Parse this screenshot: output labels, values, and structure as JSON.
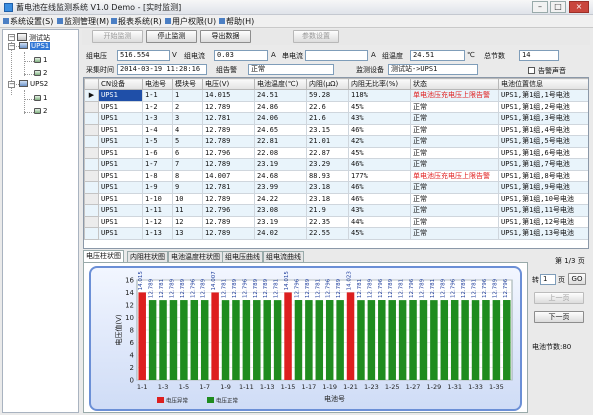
{
  "window": {
    "title": "蓄电池在线监测系统 V1.0 Demo - [实时监测]",
    "min": "–",
    "max": "□",
    "close": "×"
  },
  "menu": [
    {
      "label": "系统设置(S)"
    },
    {
      "label": "监测管理(M)"
    },
    {
      "label": "报表系统(R)"
    },
    {
      "label": "用户权限(U)"
    },
    {
      "label": "帮助(H)"
    }
  ],
  "tree": {
    "root": "测试站",
    "groups": [
      {
        "label": "UPS1",
        "children": [
          "1",
          "2"
        ]
      },
      {
        "label": "UPS2",
        "children": [
          "1",
          "2"
        ]
      }
    ]
  },
  "toolbar": {
    "start": "开始监测",
    "stop": "停止监测",
    "export": "导出数据",
    "params": "参数设置"
  },
  "info": {
    "group_voltage_label": "组电压",
    "group_voltage": "516.554",
    "v_unit": "V",
    "group_current_label": "组电流",
    "group_current": "0.03",
    "a_unit": "A",
    "string_current_label": "串电流",
    "string_current": "",
    "group_temp_label": "组温度",
    "group_temp": "24.51",
    "c_unit": "℃",
    "total_count_label": "总节数",
    "total_count": "14",
    "sample_time_label": "采集时间",
    "sample_time": "2014-03-19 11:28:16",
    "group_status_label": "组告警",
    "group_status": "正常",
    "monitor_device_label": "监测设备",
    "monitor_device": "测试站->UPS1",
    "alarm_sound_label": "告警声音"
  },
  "grid": {
    "columns": [
      "CN设备",
      "电池号",
      "模块号",
      "电压(V)",
      "电池温度(℃)",
      "内阻(μΩ)",
      "内阻无比率(%)",
      "状态",
      "电池位置信息"
    ],
    "rows": [
      [
        "UPS1",
        "1-1",
        "1",
        "14.015",
        "24.51",
        "59.28",
        "118%",
        "单电池压充电压上限告警",
        "UPS1,第1组,1号电池"
      ],
      [
        "UPS1",
        "1-2",
        "2",
        "12.789",
        "24.86",
        "22.6",
        "45%",
        "正常",
        "UPS1,第1组,2号电池"
      ],
      [
        "UPS1",
        "1-3",
        "3",
        "12.781",
        "24.06",
        "21.6",
        "43%",
        "正常",
        "UPS1,第1组,3号电池"
      ],
      [
        "UPS1",
        "1-4",
        "4",
        "12.789",
        "24.65",
        "23.15",
        "46%",
        "正常",
        "UPS1,第1组,4号电池"
      ],
      [
        "UPS1",
        "1-5",
        "5",
        "12.789",
        "22.81",
        "21.01",
        "42%",
        "正常",
        "UPS1,第1组,5号电池"
      ],
      [
        "UPS1",
        "1-6",
        "6",
        "12.796",
        "22.08",
        "22.87",
        "45%",
        "正常",
        "UPS1,第1组,6号电池"
      ],
      [
        "UPS1",
        "1-7",
        "7",
        "12.789",
        "23.19",
        "23.29",
        "46%",
        "正常",
        "UPS1,第1组,7号电池"
      ],
      [
        "UPS1",
        "1-8",
        "8",
        "14.007",
        "24.68",
        "88.93",
        "177%",
        "单电池压充电压上限告警",
        "UPS1,第1组,8号电池"
      ],
      [
        "UPS1",
        "1-9",
        "9",
        "12.781",
        "23.99",
        "23.18",
        "46%",
        "正常",
        "UPS1,第1组,9号电池"
      ],
      [
        "UPS1",
        "1-10",
        "10",
        "12.789",
        "24.22",
        "23.18",
        "46%",
        "正常",
        "UPS1,第1组,10号电池"
      ],
      [
        "UPS1",
        "1-11",
        "11",
        "12.796",
        "23.08",
        "21.9",
        "43%",
        "正常",
        "UPS1,第1组,11号电池"
      ],
      [
        "UPS1",
        "1-12",
        "12",
        "12.789",
        "23.19",
        "22.35",
        "44%",
        "正常",
        "UPS1,第1组,12号电池"
      ],
      [
        "UPS1",
        "1-13",
        "13",
        "12.789",
        "24.02",
        "22.55",
        "45%",
        "正常",
        "UPS1,第1组,13号电池"
      ]
    ]
  },
  "tabs": [
    "电压柱状图",
    "内阻柱状图",
    "电池温度柱状图",
    "组电压曲线",
    "组电流曲线"
  ],
  "chart_data": {
    "type": "bar",
    "categories": [
      "1-1",
      "1-2",
      "1-3",
      "1-4",
      "1-5",
      "1-6",
      "1-7",
      "1-8",
      "1-9",
      "1-10",
      "1-11",
      "1-12",
      "1-13",
      "1-14",
      "1-15",
      "1-16",
      "1-17",
      "1-18",
      "1-19",
      "1-20",
      "1-21",
      "1-22",
      "1-23",
      "1-24",
      "1-25",
      "1-26",
      "1-27",
      "1-28",
      "1-29",
      "1-30",
      "1-31",
      "1-32",
      "1-33",
      "1-34",
      "1-35",
      "1-36"
    ],
    "tick_labels": [
      "1-1",
      "1-3",
      "1-5",
      "1-7",
      "1-9",
      "1-11",
      "1-13",
      "1-15",
      "1-17",
      "1-19",
      "1-21",
      "1-23",
      "1-25",
      "1-27",
      "1-29",
      "1-31",
      "1-33",
      "1-35"
    ],
    "values": [
      14.015,
      12.789,
      12.781,
      12.789,
      12.789,
      12.796,
      12.789,
      14.007,
      12.781,
      12.789,
      12.796,
      12.789,
      12.789,
      12.781,
      14.015,
      12.796,
      12.789,
      12.781,
      12.796,
      12.789,
      14.023,
      12.781,
      12.789,
      12.796,
      12.789,
      12.781,
      12.796,
      12.789,
      12.781,
      12.789,
      12.796,
      12.789,
      12.781,
      12.796,
      12.789,
      12.796
    ],
    "status": [
      "abnormal",
      "normal",
      "normal",
      "normal",
      "normal",
      "normal",
      "normal",
      "abnormal",
      "normal",
      "normal",
      "normal",
      "normal",
      "normal",
      "normal",
      "abnormal",
      "normal",
      "normal",
      "normal",
      "normal",
      "normal",
      "abnormal",
      "normal",
      "normal",
      "normal",
      "normal",
      "normal",
      "normal",
      "normal",
      "normal",
      "normal",
      "normal",
      "normal",
      "normal",
      "normal",
      "normal",
      "normal"
    ],
    "ylabel": "电压值(V)",
    "xlabel": "电池号",
    "ylim": [
      0,
      16
    ],
    "yticks": [
      0,
      2,
      4,
      6,
      8,
      10,
      12,
      14,
      16
    ],
    "legend": [
      {
        "name": "电压异常",
        "color": "#dd1f1f"
      },
      {
        "name": "电压正常",
        "color": "#1f8c1f"
      }
    ],
    "colors": {
      "abnormal": "#dd1f1f",
      "normal": "#1f8c1f"
    },
    "grid": true
  },
  "pager": {
    "page_info": "第 1/3 页",
    "goto_prefix": "转",
    "goto_value": "1",
    "goto_suffix": "页",
    "go": "GO",
    "prev": "上一页",
    "next": "下一页",
    "total_label": "电池节数:80"
  }
}
